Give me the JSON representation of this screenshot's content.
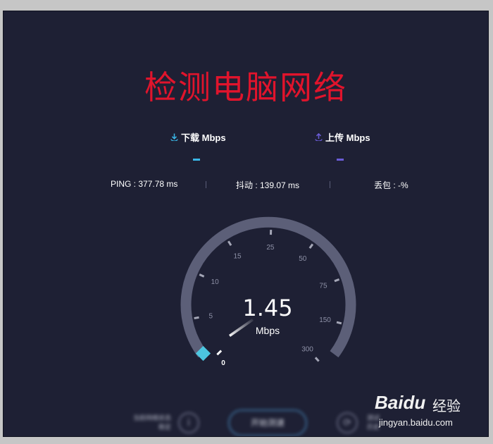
{
  "title": "检测电脑网络",
  "download": {
    "icon": "download-icon",
    "label": "下载 Mbps",
    "value": "",
    "color": "#3ab6e6"
  },
  "upload": {
    "icon": "upload-icon",
    "label": "上传 Mbps",
    "value": "",
    "color": "#6a5cd6"
  },
  "stats": {
    "ping": "PING : 377.78 ms",
    "jitter": "抖动 : 139.07 ms",
    "loss": "丢包 : -%"
  },
  "gauge": {
    "speed": "1.45",
    "unit": "Mbps",
    "current_value": 1.45,
    "ticks": [
      "0",
      "5",
      "10",
      "15",
      "25",
      "50",
      "75",
      "150",
      "300"
    ],
    "accent_color": "#4cc6e0",
    "track_color": "#5c5f78"
  },
  "footer": {
    "left_text_line1": "当前网络状态",
    "left_text_line2": "稳定",
    "start_button": "开始测速",
    "right_text_line1": "测试",
    "right_text_line2": "历史"
  },
  "watermark": {
    "brand": "Baidu",
    "product": "经验",
    "url": "jingyan.baidu.com"
  }
}
